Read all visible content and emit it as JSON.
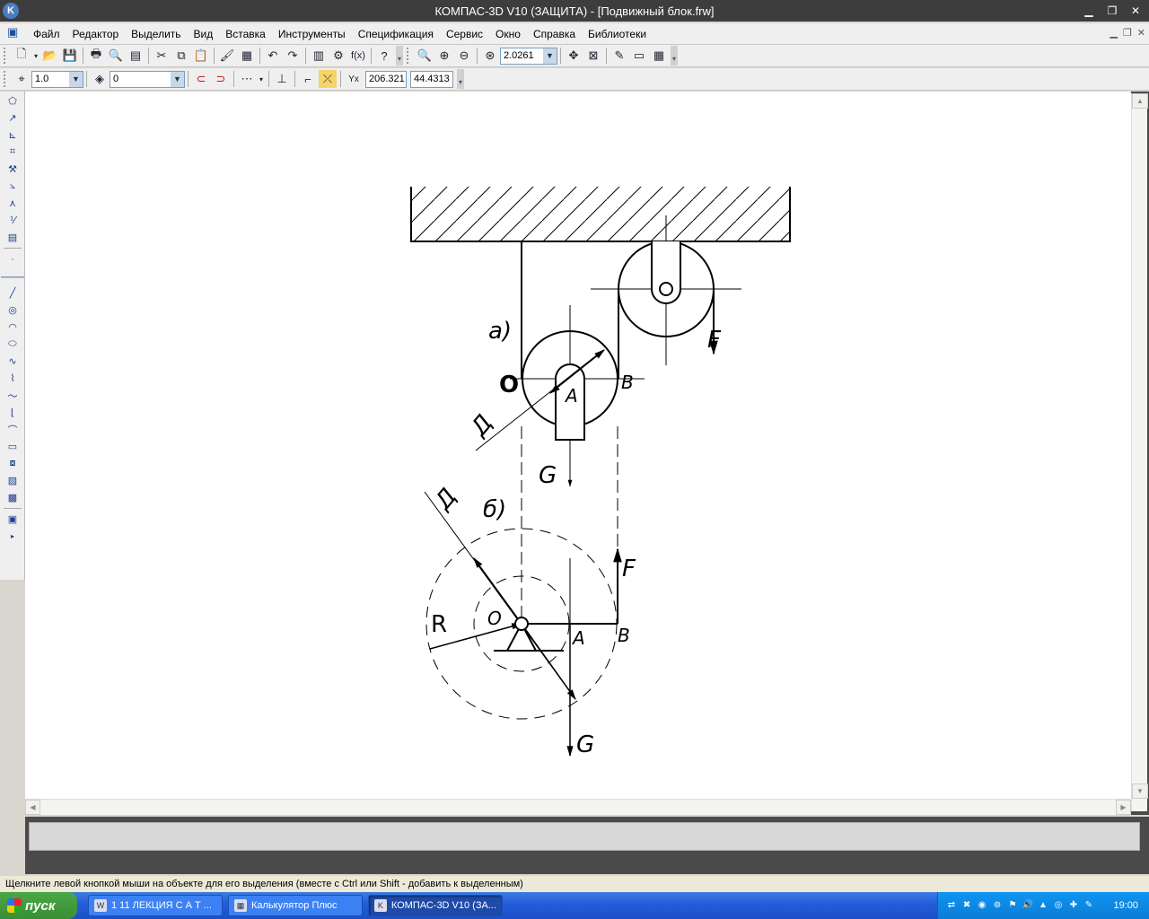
{
  "window": {
    "title": "КОМПАС-3D V10 (ЗАЩИТА) - [Подвижный блок.frw]",
    "logo_letter": "K"
  },
  "menu": [
    "Файл",
    "Редактор",
    "Выделить",
    "Вид",
    "Вставка",
    "Инструменты",
    "Спецификация",
    "Сервис",
    "Окно",
    "Справка",
    "Библиотеки"
  ],
  "toolbar1": {
    "zoom_value": "2.0261"
  },
  "toolbar2": {
    "line_scale": "1.0",
    "layer_value": "0",
    "coord_x": "206.321",
    "coord_y": "44.4313"
  },
  "drawing": {
    "label_a": "а)",
    "label_b": "б)",
    "label_O_top": "O",
    "label_A_top": "A",
    "label_B_top": "B",
    "label_F_top": "F",
    "label_G_top": "G",
    "label_D_top": "Д",
    "label_D_bottom": "Д",
    "label_R": "R",
    "label_O_bottom": "O",
    "label_A_bottom": "A",
    "label_B_bottom": "B",
    "label_F_bottom": "F",
    "label_G_bottom": "G"
  },
  "status": {
    "hint": "Щелкните левой кнопкой мыши на объекте для его выделения (вместе с Ctrl или Shift - добавить к выделенным)"
  },
  "taskbar": {
    "start_label": "пуск",
    "tasks": [
      {
        "label": "1 11 ЛЕКЦИЯ С А Т ...",
        "active": false
      },
      {
        "label": "Калькулятор Плюс",
        "active": false
      },
      {
        "label": "КОМПАС-3D V10 (ЗА...",
        "active": true
      }
    ],
    "clock": "19:00"
  }
}
